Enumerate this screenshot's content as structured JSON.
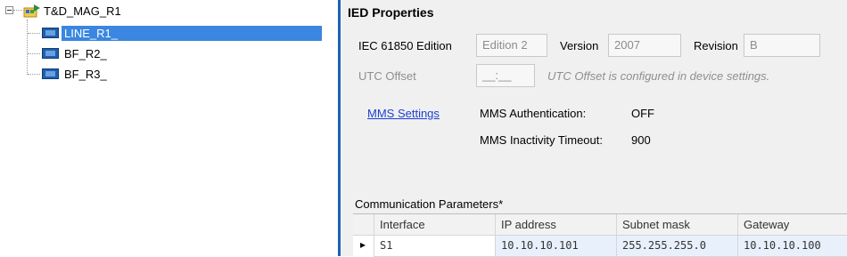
{
  "tree": {
    "root_label": "T&D_MAG_R1",
    "items": [
      {
        "label": "LINE_R1_",
        "selected": true
      },
      {
        "label": "BF_R2_",
        "selected": false
      },
      {
        "label": "BF_R3_",
        "selected": false
      }
    ]
  },
  "props": {
    "title": "IED Properties",
    "edition_label": "IEC 61850 Edition",
    "edition_value": "Edition 2",
    "version_label": "Version",
    "version_value": "2007",
    "revision_label": "Revision",
    "revision_value": "B",
    "utc_label": "UTC Offset",
    "utc_value": "__:__",
    "utc_note": "UTC Offset is configured in device settings.",
    "mms_link": "MMS Settings",
    "mms_auth_label": "MMS Authentication:",
    "mms_auth_value": "OFF",
    "mms_timeout_label": "MMS Inactivity Timeout:",
    "mms_timeout_value": "900"
  },
  "comm": {
    "title": "Communication Parameters*",
    "columns": [
      "Interface",
      "IP address",
      "Subnet mask",
      "Gateway"
    ],
    "rows": [
      [
        "S1",
        "10.10.10.101",
        "255.255.255.0",
        "10.10.10.100"
      ]
    ]
  },
  "colors": {
    "accent": "#1c62b3",
    "selection": "#3a86e0",
    "link": "#1b3fd3"
  }
}
